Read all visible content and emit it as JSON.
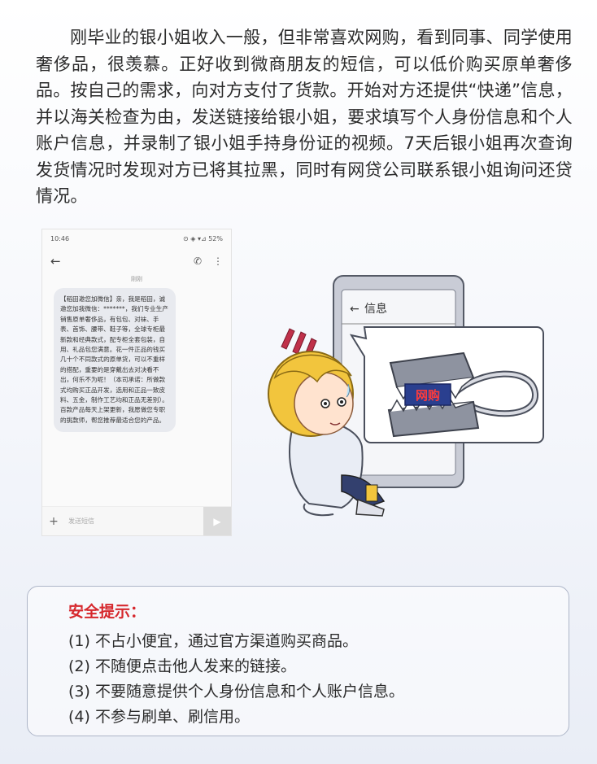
{
  "story": {
    "text": "刚毕业的银小姐收入一般，但非常喜欢网购，看到同事、同学使用奢侈品，很羡慕。正好收到微商朋友的短信，可以低价购买原单奢侈品。按自己的需求，向对方支付了货款。开始对方还提供“快递”信息，并以海关检查为由，发送链接给银小姐，要求填写个人身份信息和个人账户信息，并录制了银小姐手持身份证的视频。7天后银小姐再次查询发货情况时发现对方已将其拉黑，同时有网贷公司联系银小姐询问还贷情况。"
  },
  "phone": {
    "time": "10:46",
    "status_icons": "⊙ ◈ ▾⊿ 52%",
    "sender_tag": "刚刚",
    "message": "【稻田邀您加微信】亲，我是稻田，诚邀您加我微信：*******，我们专业生产销售原单奢侈品，有包包、对袜、手表、首饰、腰带、鞋子等，全球专柜最新款和经典款式，配专柜全套包装，自用、礼品包您满意。花一件正品的钱买几十个不同款式的原单货，可以不重样的搭配，重要的是穿戴出去对决看不出，何乐不为呢！（本司承诺：所做款式均购买正品开发，选用和正品一致皮料、五金，制作工艺均和正品无差别）。百款产品每天上架更新，我愿做您专职的挑款师，帮您推荐最适合您的产品。",
    "input_placeholder": "发送短信"
  },
  "illustration": {
    "screen_title": "信息",
    "trap_label": "网购"
  },
  "tips": {
    "title": "安全提示：",
    "items": [
      "(1) 不占小便宜，通过官方渠道购买商品。",
      "(2) 不随便点击他人发来的链接。",
      "(3) 不要随意提供个人身份信息和个人账户信息。",
      "(4) 不参与刷单、刷信用。"
    ]
  },
  "colors": {
    "tip_title": "#d6282d",
    "trap_label_bg": "#2a3f8f",
    "trap_label_text": "#ff3b3b",
    "hair": "#f2c53d"
  }
}
